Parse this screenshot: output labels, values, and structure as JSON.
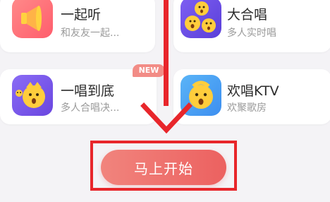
{
  "cards": {
    "listen_together": {
      "title": "一起听",
      "subtitle": "和友友一起..."
    },
    "chorus": {
      "title": "大合唱",
      "subtitle": "多人实时唱"
    },
    "sing_to_end": {
      "title": "一唱到底",
      "subtitle": "多人合唱决...",
      "badge": "NEW"
    },
    "ktv": {
      "title": "欢唱KTV",
      "subtitle": "欢聚歌房"
    }
  },
  "start_button": {
    "label": "马上开始"
  },
  "colors": {
    "annotation_red": "#e8262b",
    "button_gradient_start": "#f1847d",
    "button_gradient_end": "#ec6160",
    "badge": "#f28c86"
  }
}
